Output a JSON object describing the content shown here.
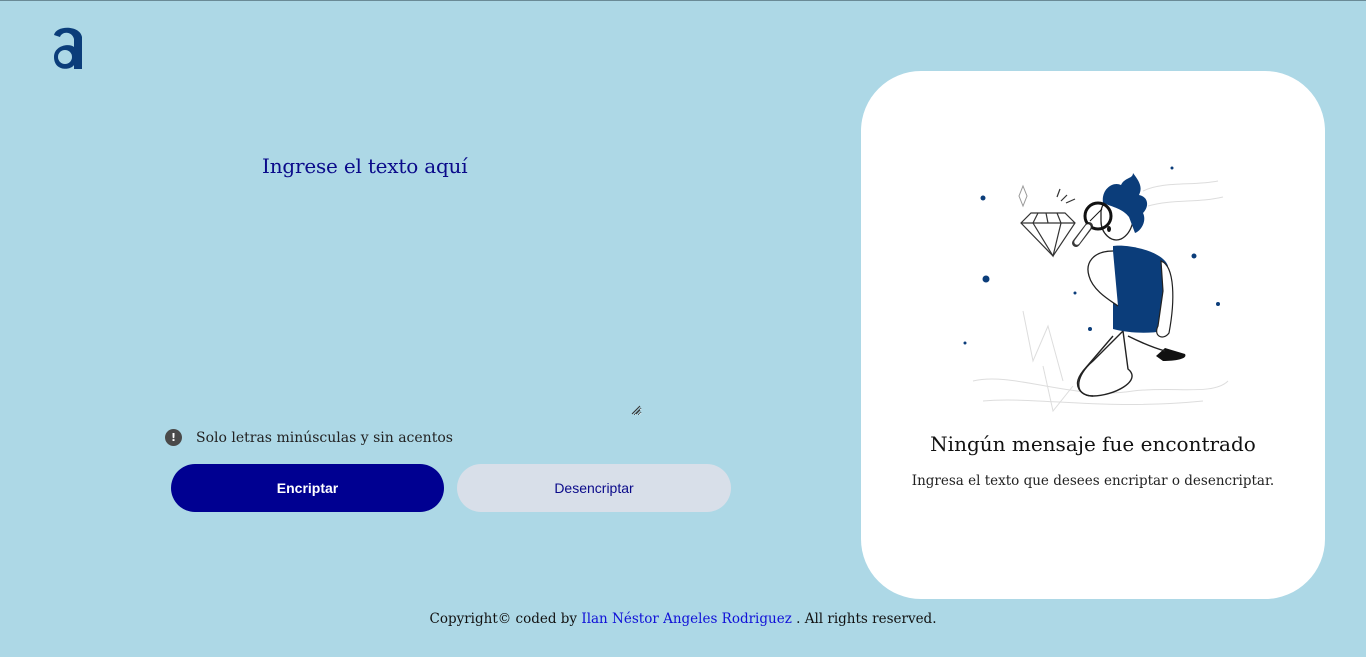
{
  "logo": {
    "icon": "a-logo-icon",
    "color": "#0b3d7a"
  },
  "input": {
    "title": "Ingrese el texto aquí",
    "value": "",
    "placeholder": ""
  },
  "notice": {
    "icon": "exclamation-circle-icon",
    "text": "Solo letras minúsculas y sin acentos"
  },
  "buttons": {
    "encrypt_label": "Encriptar",
    "decrypt_label": "Desencriptar",
    "encrypt_color": "#000091",
    "decrypt_color": "#d8dfe9"
  },
  "result": {
    "illustration": "person-with-magnifying-glass-illustration",
    "title": "Ningún mensaje fue encontrado",
    "subtitle": "Ingresa el texto que desees encriptar o desencriptar."
  },
  "footer": {
    "prefix": "Copyright© coded by ",
    "author": "Ilan Néstor Angeles Rodriguez",
    "suffix": " . All rights reserved."
  },
  "colors": {
    "background": "#add8e6",
    "accent": "#0a0a8a",
    "card": "#ffffff"
  }
}
